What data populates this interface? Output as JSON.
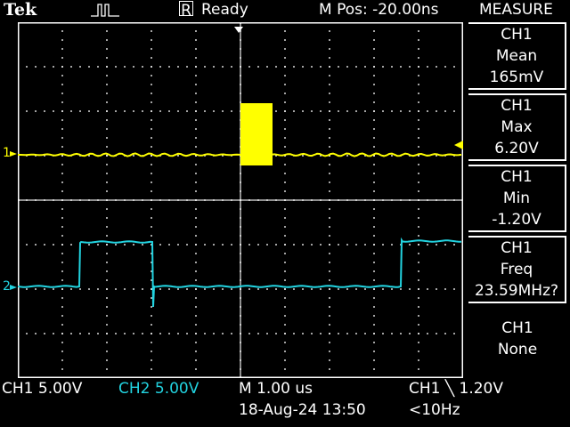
{
  "header": {
    "brand": "Tek",
    "status_flag": "R",
    "status": "Ready",
    "m_pos": "M Pos: -20.00ns"
  },
  "measure": {
    "title": "MEASURE",
    "items": [
      {
        "channel": "CH1",
        "type": "Mean",
        "value": "165mV"
      },
      {
        "channel": "CH1",
        "type": "Max",
        "value": "6.20V"
      },
      {
        "channel": "CH1",
        "type": "Min",
        "value": "-1.20V"
      },
      {
        "channel": "CH1",
        "type": "Freq",
        "value": "23.59MHz?"
      },
      {
        "channel": "CH1",
        "type": "None",
        "value": ""
      }
    ]
  },
  "markers": {
    "ch1": "1",
    "ch2": "2"
  },
  "footer": {
    "ch1_scale": "CH1  5.00V",
    "ch2_scale": "CH2  5.00V",
    "timebase": "M 1.00 us",
    "trigger": "CH1  ╲  1.20V",
    "datetime": "18-Aug-24 13:50",
    "freq": "<10Hz"
  },
  "colors": {
    "ch1": "#ffff00",
    "ch2": "#22d3e0",
    "grid": "#ffffff"
  }
}
